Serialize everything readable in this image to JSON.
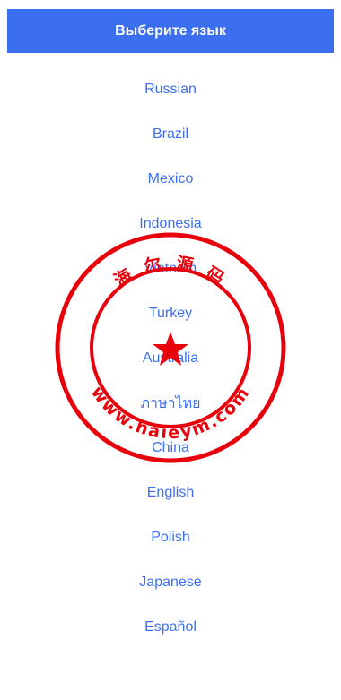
{
  "header": {
    "title": "Выберите язык"
  },
  "languages": [
    "Russian",
    "Brazil",
    "Mexico",
    "Indonesia",
    "Vietnam",
    "Turkey",
    "Australia",
    "ภาษาไทย",
    "China",
    "English",
    "Polish",
    "Japanese",
    "Español"
  ],
  "watermark": {
    "top_text": "海 尔 源 码",
    "bottom_text": "www.haieym.com",
    "color": "#e8000b"
  },
  "colors": {
    "accent": "#3c6ff0",
    "header_text": "#ffffff",
    "background": "#ffffff"
  }
}
